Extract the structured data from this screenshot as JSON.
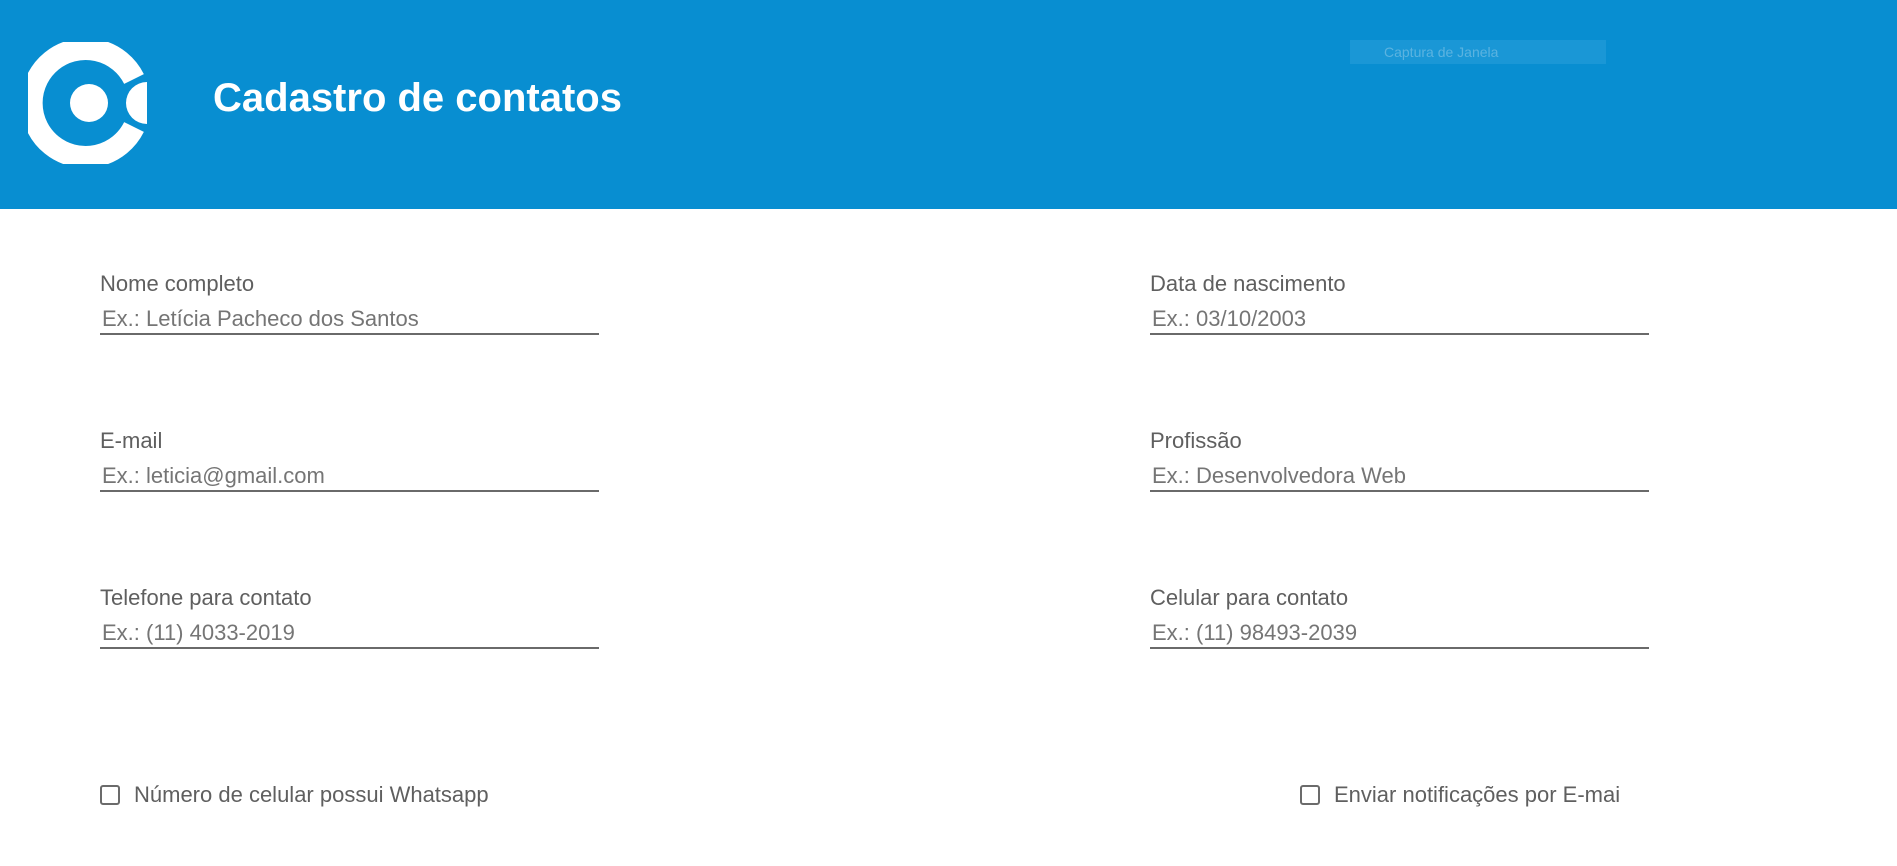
{
  "header": {
    "logo_icon": "brand-logo-icon",
    "title": "Cadastro de contatos",
    "capture_overlay": "Captura de Janela",
    "background_color": "#088ed1"
  },
  "form": {
    "full_name": {
      "label": "Nome completo",
      "placeholder": "Ex.: Letícia Pacheco dos Santos",
      "value": ""
    },
    "birth_date": {
      "label": "Data de nascimento",
      "placeholder": "Ex.: 03/10/2003",
      "value": ""
    },
    "email": {
      "label": "E-mail",
      "placeholder": "Ex.: leticia@gmail.com",
      "value": ""
    },
    "profession": {
      "label": "Profissão",
      "placeholder": "Ex.: Desenvolvedora Web",
      "value": ""
    },
    "phone": {
      "label": "Telefone para contato",
      "placeholder": "Ex.: (11) 4033-2019",
      "value": ""
    },
    "mobile": {
      "label": "Celular para contato",
      "placeholder": "Ex.: (11) 98493-2039",
      "value": ""
    },
    "whatsapp_checkbox": {
      "label": "Número de celular possui Whatsapp",
      "checked": false
    },
    "email_notifications_checkbox": {
      "label": "Enviar notificações por E-mai",
      "checked": false
    }
  }
}
